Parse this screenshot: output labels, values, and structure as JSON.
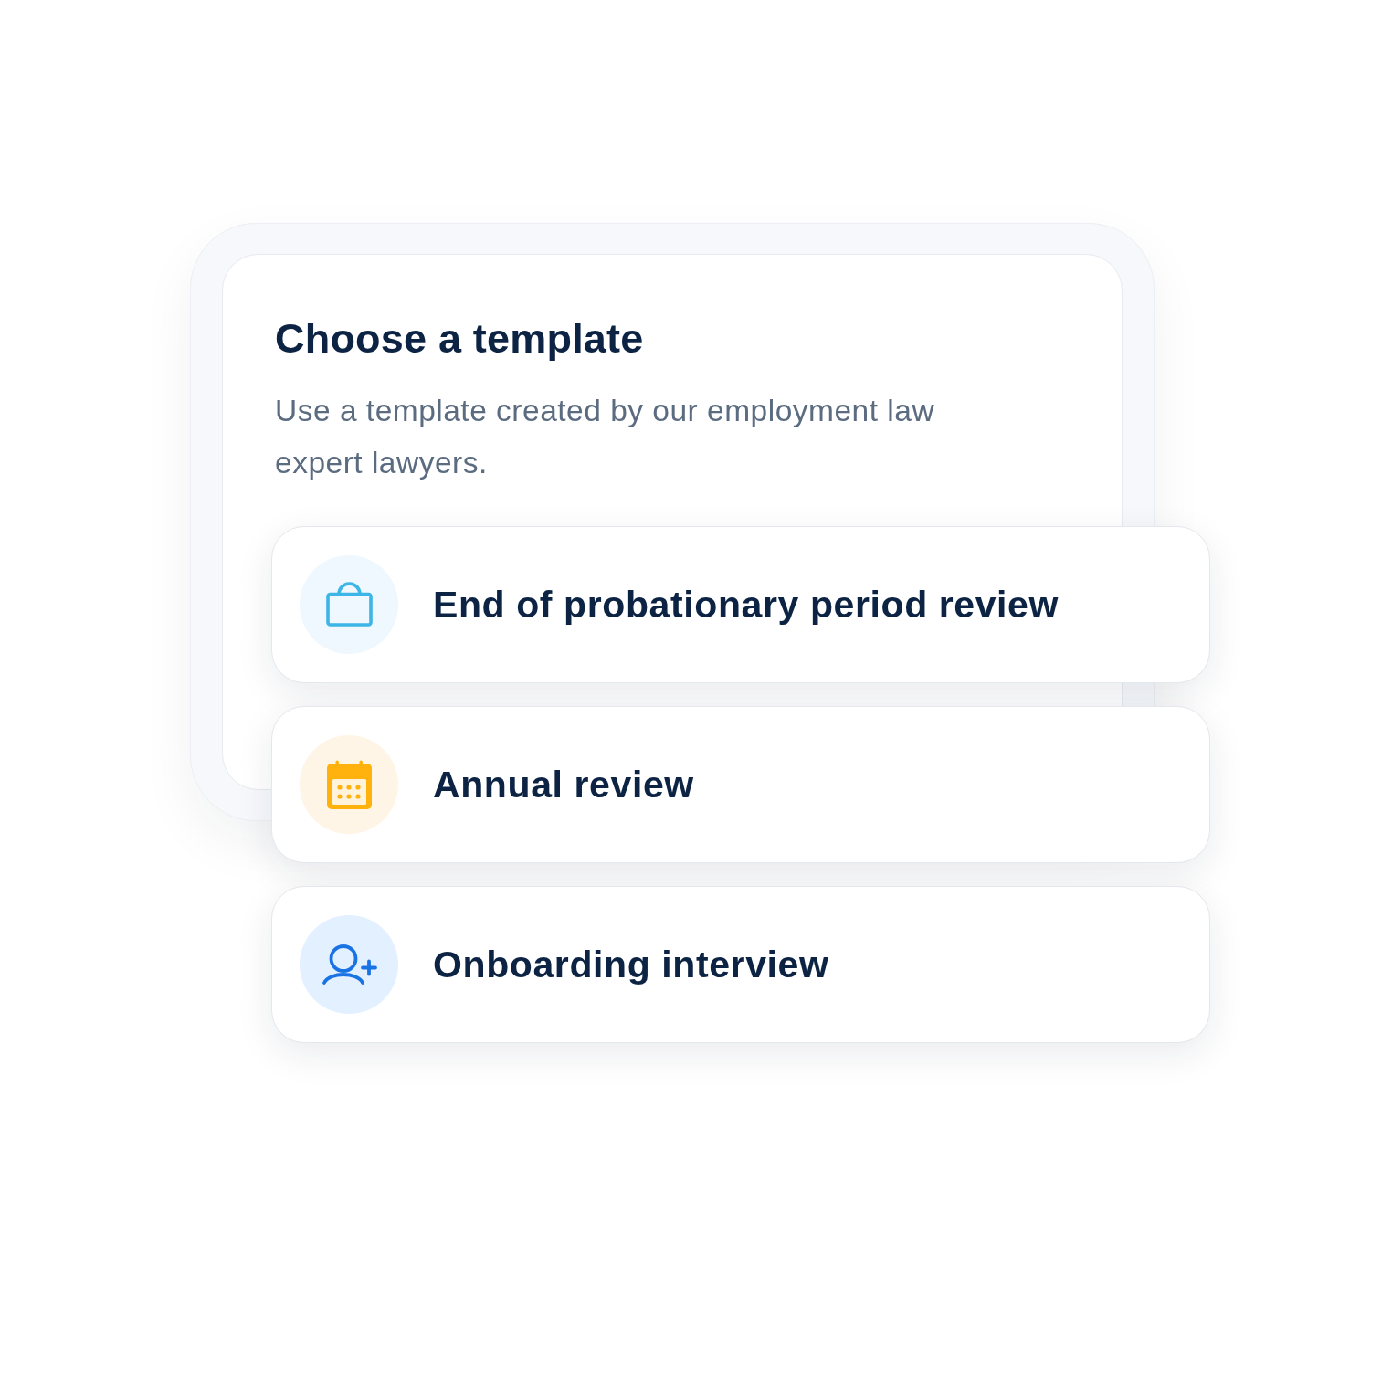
{
  "card": {
    "title": "Choose a template",
    "description": "Use a template created by our employment law expert lawyers."
  },
  "templates": [
    {
      "label": "End of probationary period review"
    },
    {
      "label": "Annual review"
    },
    {
      "label": "Onboarding interview"
    }
  ]
}
